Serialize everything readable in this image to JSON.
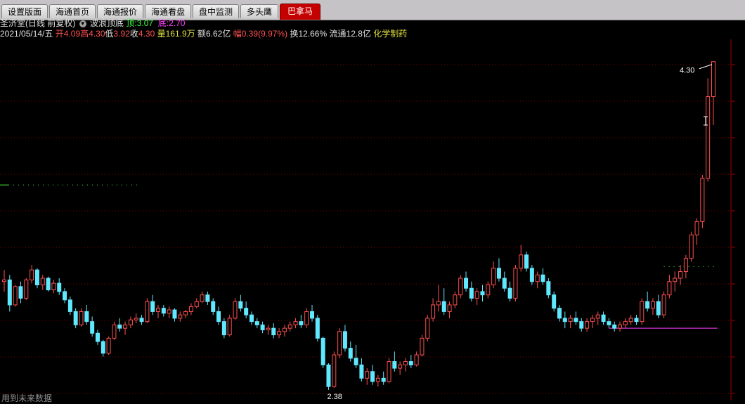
{
  "tabs": [
    {
      "label": "设置版面",
      "active": false
    },
    {
      "label": "海通首页",
      "active": false
    },
    {
      "label": "海通报价",
      "active": false
    },
    {
      "label": "海通看盘",
      "active": false
    },
    {
      "label": "盘中监测",
      "active": false
    },
    {
      "label": "多头鹰",
      "active": false
    },
    {
      "label": "巴拿马",
      "active": true
    }
  ],
  "title": {
    "stock": "圣济堂(日线 前复权)",
    "indicator": "波浪顶底",
    "top_label": "顶:",
    "top_value": "3.07",
    "bottom_label": "底:",
    "bottom_value": "2.70"
  },
  "info": {
    "date": "2021/05/14/五",
    "open_label": "开",
    "open": "4.09",
    "high_label": "高",
    "high": "4.30",
    "low_label": "低",
    "low": "3.92",
    "close_label": "收",
    "close": "4.30",
    "volume_label": "量",
    "volume": "161.9万",
    "amount_label": "额",
    "amount": "6.62亿",
    "change_label": "幅",
    "change": "0.39(9.97%)",
    "turnover_label": "换",
    "turnover": "12.66%",
    "float_label": "流通",
    "float": "12.8亿",
    "sector": "化学制药"
  },
  "annotations": {
    "high_marker": "4.30",
    "low_marker": "2.38"
  },
  "footer": "用到未来数据",
  "colors": {
    "up": "#ff5050",
    "down": "#60e8ff",
    "top_line": "#40ff40",
    "bottom_line": "#ff40ff",
    "grid": "#800000"
  },
  "chart_data": {
    "type": "candlestick",
    "ylim": [
      2.3,
      4.4
    ],
    "candles": [
      [
        2.98,
        3.05,
        2.92,
        2.99
      ],
      [
        2.99,
        3.02,
        2.8,
        2.84
      ],
      [
        2.84,
        2.96,
        2.83,
        2.95
      ],
      [
        2.95,
        2.98,
        2.85,
        2.88
      ],
      [
        2.88,
        3.0,
        2.87,
        2.99
      ],
      [
        2.99,
        3.08,
        2.97,
        3.05
      ],
      [
        3.05,
        3.06,
        2.94,
        2.96
      ],
      [
        2.96,
        3.02,
        2.93,
        3.0
      ],
      [
        3.0,
        3.01,
        2.92,
        2.93
      ],
      [
        2.93,
        2.99,
        2.91,
        2.97
      ],
      [
        2.97,
        3.0,
        2.9,
        2.92
      ],
      [
        2.92,
        2.94,
        2.85,
        2.87
      ],
      [
        2.87,
        2.89,
        2.78,
        2.8
      ],
      [
        2.8,
        2.82,
        2.7,
        2.72
      ],
      [
        2.72,
        2.82,
        2.71,
        2.8
      ],
      [
        2.8,
        2.84,
        2.72,
        2.74
      ],
      [
        2.74,
        2.77,
        2.65,
        2.67
      ],
      [
        2.67,
        2.69,
        2.6,
        2.62
      ],
      [
        2.62,
        2.63,
        2.53,
        2.55
      ],
      [
        2.55,
        2.65,
        2.54,
        2.64
      ],
      [
        2.64,
        2.74,
        2.63,
        2.72
      ],
      [
        2.72,
        2.76,
        2.68,
        2.7
      ],
      [
        2.7,
        2.74,
        2.66,
        2.72
      ],
      [
        2.72,
        2.77,
        2.7,
        2.75
      ],
      [
        2.75,
        2.79,
        2.73,
        2.76
      ],
      [
        2.76,
        2.78,
        2.72,
        2.74
      ],
      [
        2.74,
        2.88,
        2.73,
        2.86
      ],
      [
        2.86,
        2.9,
        2.78,
        2.8
      ],
      [
        2.8,
        2.84,
        2.76,
        2.82
      ],
      [
        2.82,
        2.84,
        2.77,
        2.79
      ],
      [
        2.79,
        2.83,
        2.76,
        2.81
      ],
      [
        2.81,
        2.82,
        2.74,
        2.76
      ],
      [
        2.76,
        2.8,
        2.74,
        2.78
      ],
      [
        2.78,
        2.81,
        2.76,
        2.8
      ],
      [
        2.8,
        2.85,
        2.78,
        2.83
      ],
      [
        2.83,
        2.88,
        2.82,
        2.86
      ],
      [
        2.86,
        2.92,
        2.85,
        2.9
      ],
      [
        2.9,
        2.92,
        2.84,
        2.86
      ],
      [
        2.86,
        2.88,
        2.78,
        2.8
      ],
      [
        2.8,
        2.83,
        2.72,
        2.74
      ],
      [
        2.74,
        2.76,
        2.64,
        2.66
      ],
      [
        2.66,
        2.78,
        2.65,
        2.76
      ],
      [
        2.76,
        2.88,
        2.75,
        2.86
      ],
      [
        2.86,
        2.9,
        2.8,
        2.82
      ],
      [
        2.82,
        2.86,
        2.76,
        2.78
      ],
      [
        2.78,
        2.8,
        2.72,
        2.74
      ],
      [
        2.74,
        2.76,
        2.7,
        2.72
      ],
      [
        2.72,
        2.74,
        2.67,
        2.69
      ],
      [
        2.69,
        2.72,
        2.66,
        2.7
      ],
      [
        2.7,
        2.73,
        2.64,
        2.66
      ],
      [
        2.66,
        2.7,
        2.64,
        2.68
      ],
      [
        2.68,
        2.72,
        2.65,
        2.7
      ],
      [
        2.7,
        2.74,
        2.68,
        2.72
      ],
      [
        2.72,
        2.76,
        2.7,
        2.74
      ],
      [
        2.74,
        2.78,
        2.7,
        2.72
      ],
      [
        2.72,
        2.82,
        2.7,
        2.8
      ],
      [
        2.8,
        2.84,
        2.74,
        2.76
      ],
      [
        2.76,
        2.78,
        2.62,
        2.64
      ],
      [
        2.64,
        2.65,
        2.46,
        2.48
      ],
      [
        2.48,
        2.49,
        2.33,
        2.35
      ],
      [
        2.35,
        2.56,
        2.34,
        2.54
      ],
      [
        2.54,
        2.7,
        2.52,
        2.68
      ],
      [
        2.68,
        2.72,
        2.56,
        2.58
      ],
      [
        2.58,
        2.62,
        2.5,
        2.52
      ],
      [
        2.52,
        2.6,
        2.46,
        2.48
      ],
      [
        2.48,
        2.52,
        2.38,
        2.4
      ],
      [
        2.4,
        2.46,
        2.36,
        2.44
      ],
      [
        2.44,
        2.48,
        2.36,
        2.38
      ],
      [
        2.38,
        2.42,
        2.35,
        2.4
      ],
      [
        2.4,
        2.44,
        2.36,
        2.38
      ],
      [
        2.38,
        2.52,
        2.37,
        2.5
      ],
      [
        2.5,
        2.56,
        2.44,
        2.46
      ],
      [
        2.46,
        2.5,
        2.42,
        2.48
      ],
      [
        2.48,
        2.52,
        2.44,
        2.5
      ],
      [
        2.5,
        2.54,
        2.46,
        2.48
      ],
      [
        2.48,
        2.56,
        2.47,
        2.54
      ],
      [
        2.54,
        2.66,
        2.53,
        2.64
      ],
      [
        2.64,
        2.78,
        2.62,
        2.76
      ],
      [
        2.76,
        2.88,
        2.74,
        2.84
      ],
      [
        2.84,
        2.96,
        2.8,
        2.86
      ],
      [
        2.86,
        2.94,
        2.78,
        2.8
      ],
      [
        2.8,
        2.86,
        2.76,
        2.84
      ],
      [
        2.84,
        2.92,
        2.82,
        2.9
      ],
      [
        2.9,
        3.02,
        2.88,
        3.0
      ],
      [
        3.0,
        3.04,
        2.92,
        2.94
      ],
      [
        2.94,
        2.98,
        2.86,
        2.88
      ],
      [
        2.88,
        2.94,
        2.84,
        2.92
      ],
      [
        2.92,
        2.96,
        2.86,
        2.9
      ],
      [
        2.9,
        2.98,
        2.88,
        2.96
      ],
      [
        2.96,
        3.1,
        2.94,
        3.06
      ],
      [
        3.06,
        3.12,
        2.98,
        3.0
      ],
      [
        3.0,
        3.04,
        2.92,
        2.94
      ],
      [
        2.94,
        2.98,
        2.86,
        2.88
      ],
      [
        2.88,
        3.08,
        2.86,
        3.06
      ],
      [
        3.06,
        3.2,
        3.04,
        3.14
      ],
      [
        3.14,
        3.16,
        3.04,
        3.06
      ],
      [
        3.06,
        3.08,
        2.96,
        2.98
      ],
      [
        2.98,
        3.04,
        2.94,
        3.02
      ],
      [
        3.02,
        3.06,
        2.96,
        2.98
      ],
      [
        2.98,
        3.0,
        2.88,
        2.9
      ],
      [
        2.9,
        2.92,
        2.8,
        2.82
      ],
      [
        2.82,
        2.84,
        2.74,
        2.76
      ],
      [
        2.76,
        2.8,
        2.7,
        2.74
      ],
      [
        2.74,
        2.78,
        2.7,
        2.76
      ],
      [
        2.76,
        2.8,
        2.72,
        2.74
      ],
      [
        2.74,
        2.76,
        2.68,
        2.7
      ],
      [
        2.7,
        2.76,
        2.68,
        2.74
      ],
      [
        2.74,
        2.78,
        2.7,
        2.76
      ],
      [
        2.76,
        2.8,
        2.72,
        2.78
      ],
      [
        2.78,
        2.8,
        2.72,
        2.74
      ],
      [
        2.74,
        2.76,
        2.7,
        2.72
      ],
      [
        2.72,
        2.74,
        2.68,
        2.7
      ],
      [
        2.7,
        2.74,
        2.68,
        2.72
      ],
      [
        2.72,
        2.76,
        2.7,
        2.74
      ],
      [
        2.74,
        2.78,
        2.72,
        2.76
      ],
      [
        2.76,
        2.78,
        2.72,
        2.74
      ],
      [
        2.74,
        2.88,
        2.72,
        2.86
      ],
      [
        2.86,
        2.92,
        2.8,
        2.82
      ],
      [
        2.82,
        2.88,
        2.78,
        2.86
      ],
      [
        2.86,
        2.9,
        2.76,
        2.78
      ],
      [
        2.78,
        2.92,
        2.76,
        2.9
      ],
      [
        2.9,
        3.02,
        2.88,
        2.98
      ],
      [
        2.98,
        3.04,
        2.92,
        3.0
      ],
      [
        3.0,
        3.08,
        2.96,
        3.04
      ],
      [
        3.04,
        3.14,
        3.0,
        3.12
      ],
      [
        3.12,
        3.28,
        3.1,
        3.26
      ],
      [
        3.26,
        3.36,
        3.2,
        3.34
      ],
      [
        3.34,
        3.62,
        3.3,
        3.6
      ],
      [
        3.6,
        4.2,
        3.58,
        4.09
      ],
      [
        4.09,
        4.3,
        3.92,
        4.3
      ]
    ],
    "top_level": 3.07,
    "bottom_level": 2.7
  }
}
